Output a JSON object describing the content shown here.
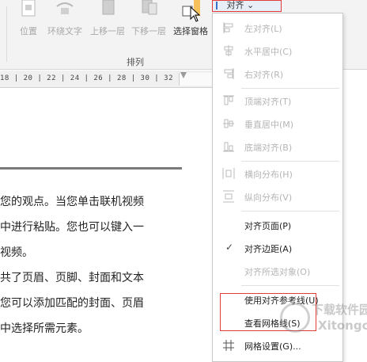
{
  "ribbon": {
    "buttons": [
      {
        "label": "位置",
        "icon": "position-icon"
      },
      {
        "label": "环绕文字",
        "icon": "wrap-text-icon"
      },
      {
        "label": "上移一层",
        "icon": "bring-forward-icon"
      },
      {
        "label": "下移一层",
        "icon": "send-backward-icon"
      },
      {
        "label": "选择窗格",
        "icon": "selection-pane-icon"
      }
    ],
    "group_label": "排列",
    "align_button_label": "对齐",
    "align_arrow": "⌄"
  },
  "ruler": {
    "text": "18  |  20  |  22  |  24  |  26  |  28  |  30  |  32"
  },
  "document": {
    "lines": [
      "您的观点。当您单击联机视频",
      "中进行粘贴。您也可以键入一",
      "视频。",
      "共了页眉、页脚、封面和文本",
      "您可以添加匹配的封面、页眉",
      "中选择所需元素。"
    ]
  },
  "menu": {
    "items": [
      {
        "label": "左对齐(L)",
        "enabled": false,
        "icon": "align-left-icon"
      },
      {
        "label": "水平居中(C)",
        "enabled": false,
        "icon": "align-center-icon"
      },
      {
        "label": "右对齐(R)",
        "enabled": false,
        "icon": "align-right-icon"
      },
      {
        "label": "顶端对齐(T)",
        "enabled": false,
        "icon": "align-top-icon"
      },
      {
        "label": "垂直居中(M)",
        "enabled": false,
        "icon": "align-middle-icon"
      },
      {
        "label": "底端对齐(B)",
        "enabled": false,
        "icon": "align-bottom-icon"
      },
      {
        "label": "横向分布(H)",
        "enabled": false,
        "icon": "distribute-horizontal-icon"
      },
      {
        "label": "纵向分布(V)",
        "enabled": false,
        "icon": "distribute-vertical-icon"
      },
      {
        "label": "对齐页面(P)",
        "enabled": true,
        "icon": ""
      },
      {
        "label": "对齐边距(A)",
        "enabled": true,
        "icon": "",
        "checked": true
      },
      {
        "label": "对齐所选对象(O)",
        "enabled": false,
        "icon": ""
      },
      {
        "label": "使用对齐参考线(U)",
        "enabled": true,
        "icon": ""
      },
      {
        "label": "查看网格线(S)",
        "enabled": true,
        "icon": ""
      },
      {
        "label": "网格设置(G)...",
        "enabled": true,
        "icon": "grid-settings-icon"
      }
    ],
    "check_glyph": "✓"
  },
  "watermark": {
    "line1": "下载软件园",
    "line2": "Xitongcheng"
  },
  "colors": {
    "highlight": "#e23b3b",
    "disabled_text": "#b5b5b5"
  }
}
